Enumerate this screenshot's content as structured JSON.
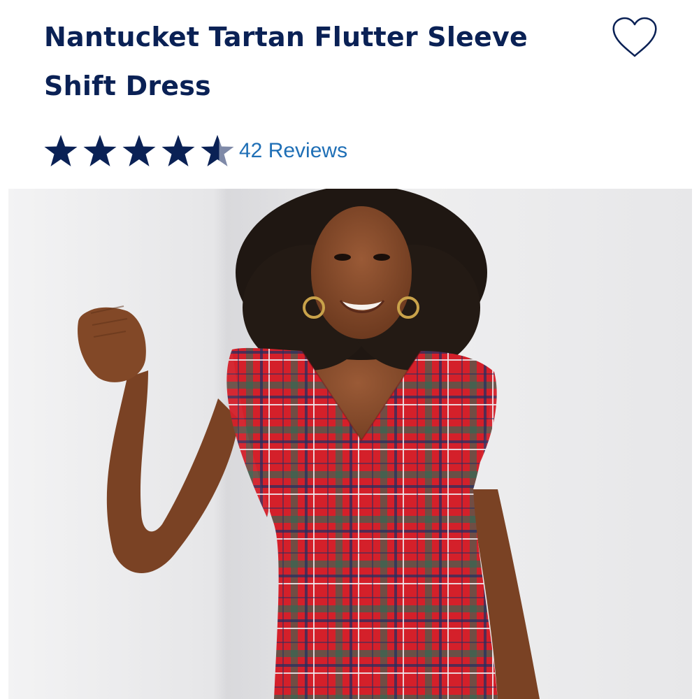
{
  "product": {
    "title": "Nantucket Tartan Flutter Sleeve Shift Dress",
    "wishlist_icon": "heart-outline-icon",
    "rating": {
      "stars_filled": 4.5,
      "stars_total": 5,
      "reviews_label": "42 Reviews",
      "star_color": "#0a2155"
    },
    "image": {
      "subject": "product-photo",
      "dress_color": "#d4202a",
      "plaid_green": "#2f6a55",
      "plaid_navy": "#1e2f63"
    }
  },
  "colors": {
    "title": "#0a2155",
    "link": "#1f6fb6",
    "background": "#ffffff"
  }
}
